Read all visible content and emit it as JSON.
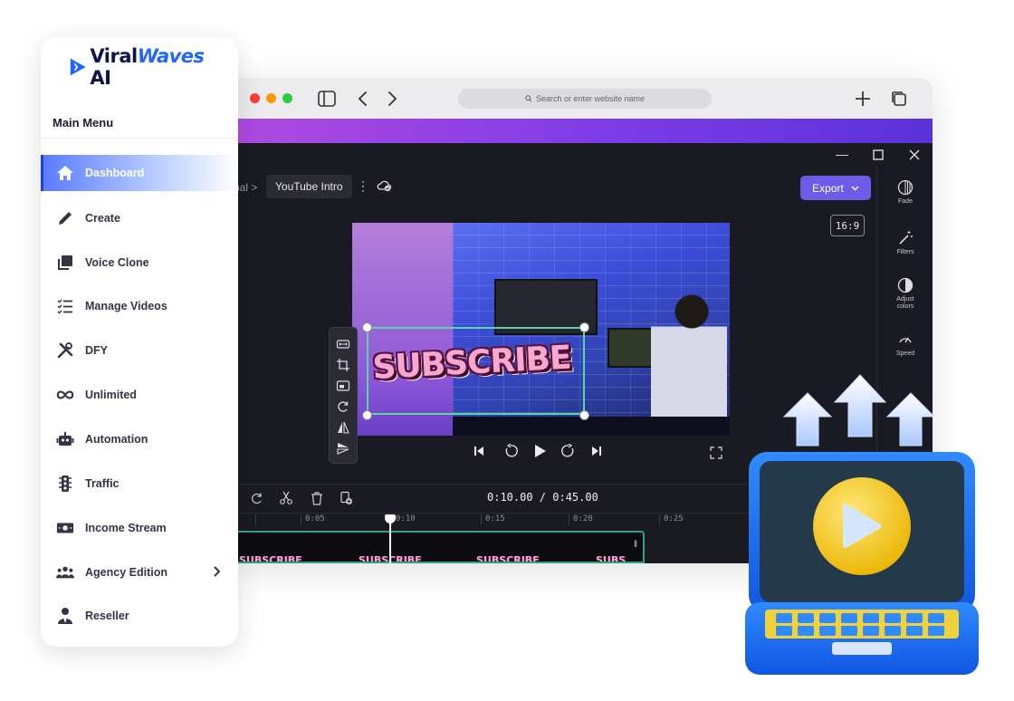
{
  "sidebar": {
    "brand_prefix": "Viral",
    "brand_wave": "Waves",
    "brand_suffix": "AI",
    "heading": "Main Menu",
    "items": [
      {
        "label": "Dashboard",
        "icon": "home-icon"
      },
      {
        "label": "Create",
        "icon": "pencil-icon"
      },
      {
        "label": "Voice Clone",
        "icon": "copy-icon"
      },
      {
        "label": "Manage Videos",
        "icon": "checklist-icon"
      },
      {
        "label": "DFY",
        "icon": "tools-icon"
      },
      {
        "label": "Unlimited",
        "icon": "infinity-icon"
      },
      {
        "label": "Automation",
        "icon": "robot-icon"
      },
      {
        "label": "Traffic",
        "icon": "traffic-light-icon"
      },
      {
        "label": "Income Stream",
        "icon": "money-icon"
      },
      {
        "label": "Agency Edition",
        "icon": "users-icon"
      },
      {
        "label": "Reseller",
        "icon": "user-tie-icon"
      }
    ],
    "active_index": 0
  },
  "browser": {
    "url_placeholder": "Search or enter website name"
  },
  "editor": {
    "breadcrumb_prev": "nal",
    "breadcrumb_sep": ">",
    "project_title": "YouTube Intro",
    "export_label": "Export",
    "aspect_ratio": "16:9",
    "overlay_text": "SUBSCRIBE",
    "timecode": "0:10.00 / 0:45.00",
    "ruler_ticks": [
      "0:05",
      "0:10",
      "0:15",
      "0:20",
      "0:25"
    ],
    "clip_labels": [
      "SUBSCRIBE",
      "SUBSCRIBE",
      "SUBSCRIBE",
      "SUBS"
    ],
    "right_panel": [
      {
        "label": "Fade",
        "icon": "fade-icon"
      },
      {
        "label": "Filters",
        "icon": "magic-wand-icon"
      },
      {
        "label": "Adjust colors",
        "icon": "contrast-icon"
      },
      {
        "label": "Speed",
        "icon": "speedometer-icon"
      }
    ],
    "accent": "#6c5ce7",
    "selection_color": "#58d6a6"
  }
}
